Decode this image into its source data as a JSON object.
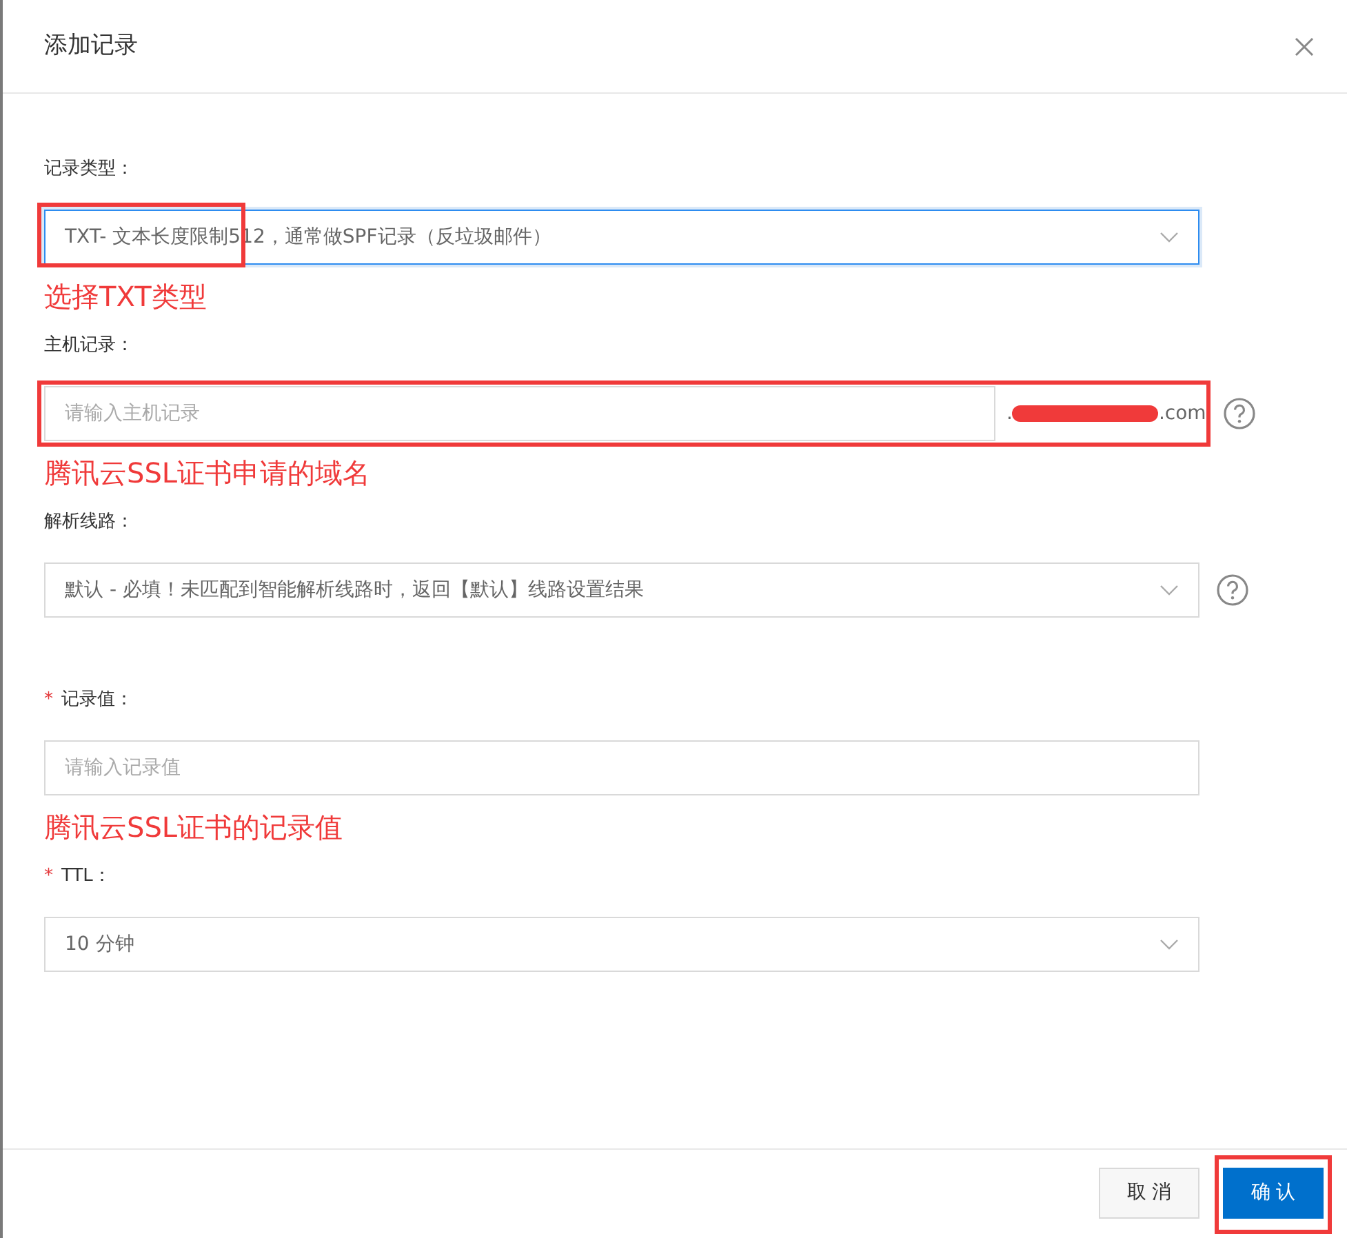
{
  "dialog": {
    "title": "添加记录"
  },
  "fields": [
    {
      "kind": "select",
      "label": "记录类型：",
      "value": "TXT- 文本长度限制512，通常做SPF记录（反垃圾邮件）",
      "focused": true,
      "help": false,
      "highlight": {
        "kind": "start"
      },
      "note": "选择TXT类型"
    },
    {
      "kind": "input",
      "label": "主机记录：",
      "placeholder": "请输入主机记录",
      "suffix_parts": [
        ".",
        ".com"
      ],
      "focused": false,
      "help": true,
      "highlight": {
        "kind": "row"
      },
      "note": "腾讯云SSL证书申请的域名"
    },
    {
      "kind": "select",
      "label": "解析线路：",
      "value": "默认 - 必填！未匹配到智能解析线路时，返回【默认】线路设置结果",
      "focused": false,
      "help": true
    },
    {
      "kind": "input",
      "required_mark": "*",
      "label": "记录值：",
      "placeholder": "请输入记录值",
      "focused": false,
      "help": false,
      "note": "腾讯云SSL证书的记录值"
    },
    {
      "kind": "select",
      "required_mark": "*",
      "label": "TTL：",
      "value": "10 分钟",
      "focused": false,
      "help": false
    }
  ],
  "buttons": [
    {
      "label": "取 消",
      "kind": "secondary",
      "highlighted": false
    },
    {
      "label": "确 认",
      "kind": "primary",
      "highlighted": true
    }
  ]
}
